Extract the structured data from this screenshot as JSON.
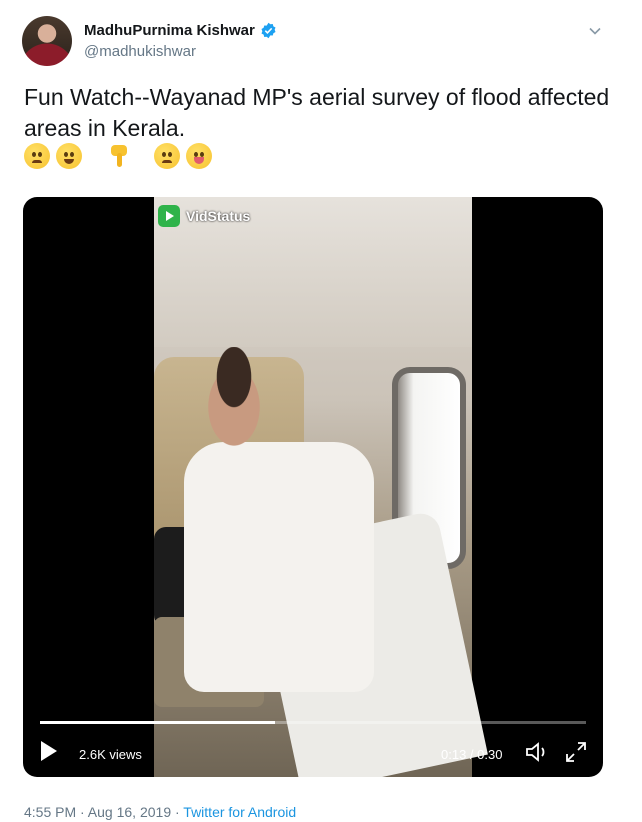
{
  "author": {
    "display_name": "MadhuPurnima Kishwar",
    "handle": "@madhukishwar",
    "verified": true
  },
  "tweet": {
    "text": "Fun Watch--Wayanad MP's aerial survey of flood affected areas in Kerala.",
    "emojis": [
      "worried-face",
      "grinning-face",
      "backhand-index-pointing-down",
      "worried-face",
      "face-with-tongue"
    ]
  },
  "video": {
    "watermark": "VidStatus",
    "views": "2.6K views",
    "time": "0:13 / 0:30",
    "progress_fraction": 0.43
  },
  "meta": {
    "timestamp": "4:55 PM · Aug 16, 2019 · ",
    "source": "Twitter for Android"
  },
  "colors": {
    "link": "#1b95e0",
    "verified": "#1da1f2",
    "secondary_text": "#657786"
  }
}
